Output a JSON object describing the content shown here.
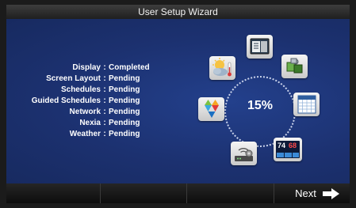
{
  "title": "User Setup Wizard",
  "status_items": [
    {
      "label": "Display",
      "sep": ":",
      "value": "Completed"
    },
    {
      "label": "Screen Layout",
      "sep": ":",
      "value": "Pending"
    },
    {
      "label": "Schedules",
      "sep": ":",
      "value": "Pending"
    },
    {
      "label": "Guided Schedules",
      "sep": ":",
      "value": "Pending"
    },
    {
      "label": "Network",
      "sep": ":",
      "value": "Pending"
    },
    {
      "label": "Nexia",
      "sep": ":",
      "value": "Pending"
    },
    {
      "label": "Weather",
      "sep": ":",
      "value": "Pending"
    }
  ],
  "progress": {
    "text": "15%",
    "value": 0.15
  },
  "wheel_icons": [
    "screen-layout-icon",
    "puzzle-icon",
    "calendar-icon",
    "thermostat-display-icon",
    "network-router-icon",
    "nexia-logo-icon",
    "weather-icon"
  ],
  "thermostat_display": {
    "temp_a": "74",
    "temp_b": "68"
  },
  "next_button": {
    "label": "Next"
  },
  "colors": {
    "background": "#1a2a5c",
    "title_bar": "#2d2d2d",
    "text": "#ffffff"
  }
}
